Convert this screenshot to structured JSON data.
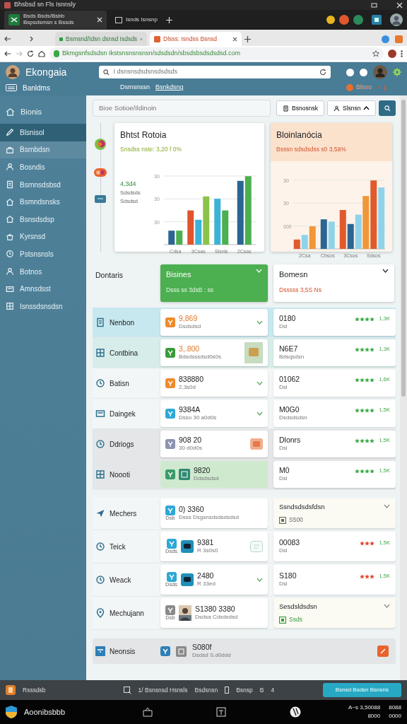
{
  "window": {
    "title": "Bhsbsd sn Fls Isnnsly"
  },
  "os_tabs": [
    {
      "title": "Bsds Bsds/Bsbb",
      "subtitle": "Bspsdsmsn s Bssds",
      "selected": true
    },
    {
      "title": "Isnds Isnsnp",
      "selected": false
    }
  ],
  "browser_tabs": [
    {
      "title": "Bsmsnd/Idsn dsnsd Isdsds",
      "selected": false
    },
    {
      "title": "Dlsss: Isndss Bsnsd",
      "selected": true
    }
  ],
  "address": {
    "url": "Bkmgsnfsdsdsn Ikstsnsnsnsnsn/sdsdsdn/sbsdsbsdsdsdsd.com"
  },
  "app": {
    "name": "Ekongaia",
    "search": {
      "placeholder": "I dsnsnsdsdsnsdsdsds"
    },
    "subnav_label": "Banldms",
    "nav": [
      {
        "label": "Dsmsnssn",
        "selected": false
      },
      {
        "label": "Bsnkdsng",
        "selected": true
      }
    ],
    "alert": "Blsso"
  },
  "sidebar": {
    "heading": "Bionis",
    "items": [
      {
        "label": "Blsnisol",
        "selected": true,
        "hovered": false
      },
      {
        "label": "Bsrnbdsn",
        "selected": false,
        "hovered": true
      },
      {
        "label": "Bosndis",
        "selected": false,
        "hovered": false
      },
      {
        "label": "Bsrnnsdsbsd",
        "selected": false,
        "hovered": false
      },
      {
        "label": "Bsmndsnsks",
        "selected": false,
        "hovered": false
      },
      {
        "label": "Bsnsdsdsp",
        "selected": false,
        "hovered": false
      },
      {
        "label": "Kyrsnsd",
        "selected": false,
        "hovered": false
      },
      {
        "label": "Pstsnsnsls",
        "selected": false,
        "hovered": false
      },
      {
        "label": "Botnos",
        "selected": false,
        "hovered": false
      },
      {
        "label": "Amnsdsst",
        "selected": false,
        "hovered": false
      },
      {
        "label": "Isnssdsnsdsn",
        "selected": false,
        "hovered": false
      }
    ]
  },
  "filter": {
    "placeholder": "Bioe Sotioe/Ildinoin"
  },
  "buttons": [
    {
      "label": "Bsnosnsk",
      "caret": false
    },
    {
      "label": "Slsnsn",
      "caret": true
    }
  ],
  "charts": [
    {
      "title": "Bhtst Rotoia",
      "subtitle": "Snsdss nste: 3,20 f 0%",
      "kind": "plain",
      "side_texts": [
        "4,3d4",
        "Sdsdsds",
        "Sdsdsd"
      ],
      "tick_labels": [
        "30",
        "30",
        "30"
      ],
      "category_labels": [
        "Cdsa",
        "3Csas",
        "Slsnls",
        "2Csas"
      ]
    },
    {
      "title": "Bloinlanócia",
      "subtitle": "Bsssn sdsdsdss s0 3,5ä%",
      "kind": "warm",
      "tick_labels": [
        "30",
        "30",
        "000"
      ],
      "category_labels": [
        "2Csa",
        "Cbsos",
        "3Csos",
        "Sdsos"
      ]
    }
  ],
  "table": {
    "heading": "Dontaris",
    "columns": [
      {
        "title": "Bisines",
        "subtitle": "Dsss ss 3dsB : ss",
        "selected": true
      },
      {
        "title": "Bomesn",
        "subtitle": "Dsssss 3,5S Ns",
        "selected": false
      }
    ],
    "rows": [
      {
        "label": "Nenbon",
        "color": "#c8e8ef",
        "item": {
          "kind": "plain",
          "value": "9,869",
          "sub": "Dsdsdsd",
          "emphasis": true,
          "color": "#f08a2c",
          "expandable": true,
          "highlight": false
        },
        "detail": {
          "kind": "rating",
          "title": "0180",
          "sub": "Dsl",
          "stars": 4,
          "color": "#3aa845",
          "rating": "1,3K"
        }
      },
      {
        "label": "Contbina",
        "color": "#d7ede9",
        "item": {
          "kind": "plain",
          "value": "3,.800",
          "sub": "Bdsdsssdsd0s0s",
          "emphasis": true,
          "color": "#3a9a3c",
          "expandable": false,
          "accessory": {
            "kind": "thumb"
          },
          "highlight": false
        },
        "detail": {
          "kind": "rating",
          "title": "N6E7",
          "sub": "Bdsqsdsn",
          "stars": 4,
          "color": "#3aa845",
          "rating": "1,3K"
        }
      },
      {
        "label": "Batisn",
        "color": "#f2f6f7",
        "item": {
          "kind": "plain",
          "value": "838880",
          "sub": "2,3s0d",
          "emphasis": false,
          "color": "#f08a2c",
          "expandable": true,
          "highlight": false
        },
        "detail": {
          "kind": "rating",
          "title": "01062",
          "sub": "Dsl",
          "stars": 4,
          "color": "#3aa845",
          "rating": "1,6K"
        }
      },
      {
        "label": "Daingek",
        "color": "#f2f6f7",
        "item": {
          "kind": "plain",
          "value": "9384A",
          "sub": "Dsso 30 a0d0s",
          "emphasis": false,
          "color": "#2ea8d6",
          "expandable": true,
          "highlight": false
        },
        "detail": {
          "kind": "rating",
          "title": "M0G0",
          "sub": "Dsdsdsdsn",
          "stars": 4,
          "color": "#3aa845",
          "rating": "1,5K"
        }
      },
      {
        "label": "Ddriogs",
        "color": "#e4e6e7",
        "item": {
          "kind": "plain",
          "value": "908 20",
          "sub": "30 d0d0s",
          "emphasis": false,
          "color": "#8a93b0",
          "expandable": false,
          "accessory": {
            "kind": "stamp"
          },
          "highlight": false
        },
        "detail": {
          "kind": "rating",
          "title": "Dlonrs",
          "sub": "Dsl",
          "stars": 4,
          "color": "#3aa845",
          "rating": "1,5K"
        }
      },
      {
        "label": "Noooti",
        "color": "#e4e6e7",
        "item": {
          "kind": "tile",
          "value": "9820",
          "sub": "Ddsdsdsd",
          "emphasis": false,
          "color": "#3a9a6c",
          "expandable": false,
          "highlight": true
        },
        "detail": {
          "kind": "rating",
          "title": "M0",
          "sub": "Dsl",
          "stars": 4,
          "color": "#3aa845",
          "rating": "1,5K"
        }
      },
      {
        "label": "Mechers",
        "color": "#f2f6f7",
        "item": {
          "kind": "plain",
          "value": "0) 3360",
          "sub": "Dsss Dsgsnsdsdsdsdsd",
          "note": "Dsb",
          "emphasis": false,
          "color": "#2ea8d6",
          "expandable": false,
          "highlight": false
        },
        "detail": {
          "kind": "dropdown",
          "title": "Ssndsdsdsfdsn",
          "sub": "S500",
          "color": "#6b6b6b"
        }
      },
      {
        "label": "Teick",
        "color": "#f2f6f7",
        "item": {
          "kind": "app",
          "value": "9381",
          "sub": "R 3s0s0",
          "note": "Dsds",
          "emphasis": false,
          "color": "#2ea8d6",
          "expandable": false,
          "accessory": {
            "kind": "outline"
          },
          "highlight": false
        },
        "detail": {
          "kind": "rating",
          "title": "00083",
          "sub": "Dsl",
          "stars": 3,
          "color": "#e0452e",
          "rating": "1,5K"
        }
      },
      {
        "label": "Weack",
        "color": "#f2f6f7",
        "item": {
          "kind": "app",
          "value": "2480",
          "sub": "R 33ed",
          "note": "Dsds",
          "emphasis": false,
          "color": "#2ea8d6",
          "expandable": true,
          "highlight": false
        },
        "detail": {
          "kind": "rating",
          "title": "S180",
          "sub": "Dsl",
          "stars": 3,
          "color": "#e0452e",
          "rating": "1,5K"
        }
      },
      {
        "label": "Mechujann",
        "color": "#f2f6f7",
        "item": {
          "value": "S1380 3380",
          "sub": "Dsdsa Cdsdsdsd",
          "note": "Dsb",
          "emphasis": false,
          "color": "#8a8a8a",
          "expandable": false,
          "highlight": false
        },
        "detail": {
          "kind": "dropdown",
          "title": "Sesdsldsdsn",
          "sub": "Ssds",
          "color": "#3a9a3c"
        }
      }
    ],
    "footer": {
      "label": "Neonsis",
      "value": "S080f",
      "sub": "Dsdsd S.d0ddd",
      "color": "#2e7fb8"
    }
  },
  "status_bar": {
    "app": "Rsssdsb",
    "path": "1/ Bsnsnsd Hsnsls",
    "crumb": "Bsdsnsn",
    "page": "Bsnsp",
    "page_number": "B",
    "count": "4",
    "action": "Bsnsd Bsdsn Bsnsns"
  },
  "taskbar": {
    "label": "Aoonibsbbb",
    "clock": [
      "A~s 3,50088",
      "8088",
      "8000",
      "0000"
    ]
  }
}
